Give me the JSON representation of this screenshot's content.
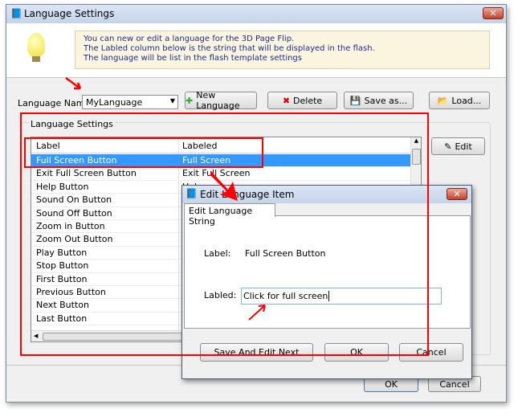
{
  "window": {
    "title": "Language Settings",
    "close": "✕"
  },
  "info": {
    "lines": [
      "You can new or edit  a language for the 3D Page Flip.",
      "The Labled column below is the string that will be displayed in the flash.",
      "The language will be list in the flash template settings"
    ]
  },
  "toolbar": {
    "language_name_label": "Language Name:",
    "language_value": "MyLanguage",
    "new_language": "New Language",
    "delete": "Delete",
    "save_as": "Save as...",
    "load": "Load..."
  },
  "group": {
    "title": "Language Settings",
    "edit": "Edit"
  },
  "table": {
    "headers": [
      "Label",
      "Labeled"
    ],
    "rows": [
      [
        "Full Screen Button",
        "Full Screen"
      ],
      [
        "Exit Full Screen Button",
        "Exit Full Screen"
      ],
      [
        "Help Button",
        "Help"
      ],
      [
        "Sound On Button",
        ""
      ],
      [
        "Sound Off Button",
        ""
      ],
      [
        "Zoom in Button",
        ""
      ],
      [
        "Zoom Out Button",
        ""
      ],
      [
        "Play Button",
        ""
      ],
      [
        "Stop Button",
        ""
      ],
      [
        "First Button",
        ""
      ],
      [
        "Previous Button",
        ""
      ],
      [
        "Next Button",
        ""
      ],
      [
        "Last Button",
        ""
      ]
    ]
  },
  "footer": {
    "ok": "OK",
    "cancel": "Cancel"
  },
  "dialog": {
    "title": "Edit Language Item",
    "close": "✕",
    "tab": "Edit Language String",
    "label_caption": "Label:",
    "label_value": "Full Screen Button",
    "labeled_caption": "Labled:",
    "labeled_value": "Click for full screen",
    "save_next": "Save And Edit Next",
    "ok": "OK",
    "cancel": "Cancel"
  },
  "colors": {
    "selection": "#3399ff",
    "annotation": "#ff0000",
    "info_bg": "#fbf5e0"
  }
}
